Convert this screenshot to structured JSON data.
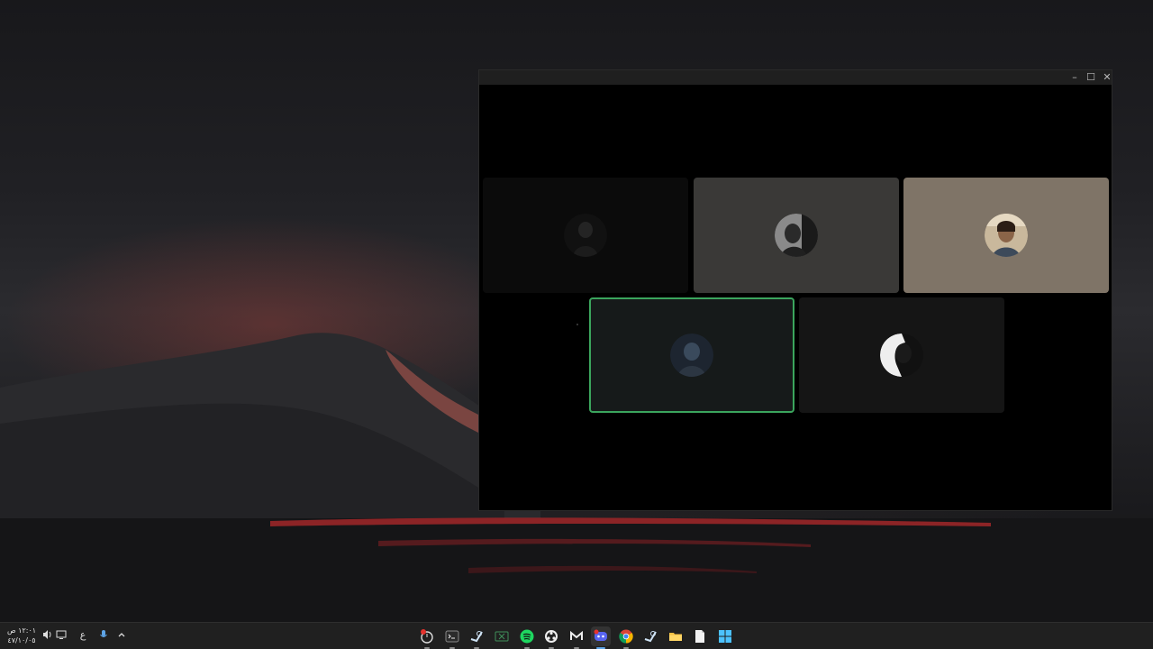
{
  "window": {
    "controls": {
      "minimize": "–",
      "maximize": "☐",
      "close": "✕"
    }
  },
  "participants": [
    {
      "id": "p1",
      "speaking": false,
      "tile_color": "#0b0b0b"
    },
    {
      "id": "p2",
      "speaking": false,
      "tile_color": "#3a3937"
    },
    {
      "id": "p3",
      "speaking": false,
      "tile_color": "#7f7467"
    },
    {
      "id": "p4",
      "speaking": true,
      "tile_color": "#161a1a",
      "ring_color": "#3ba55d"
    },
    {
      "id": "p5",
      "speaking": false,
      "tile_color": "#151515"
    }
  ],
  "taskbar": {
    "clock": {
      "time": "١٢:٠١ ص",
      "date": "٤٧/١٠/٠٥"
    },
    "language": "ع",
    "tray_icons": [
      "speaker-icon",
      "network-icon",
      "microphone-icon",
      "chevron-up-icon"
    ],
    "apps": [
      "screen-recorder",
      "terminal",
      "steam",
      "xbox",
      "spotify",
      "obs",
      "medal",
      "discord",
      "chrome",
      "steam",
      "file-explorer",
      "notepad",
      "windows-start"
    ]
  }
}
